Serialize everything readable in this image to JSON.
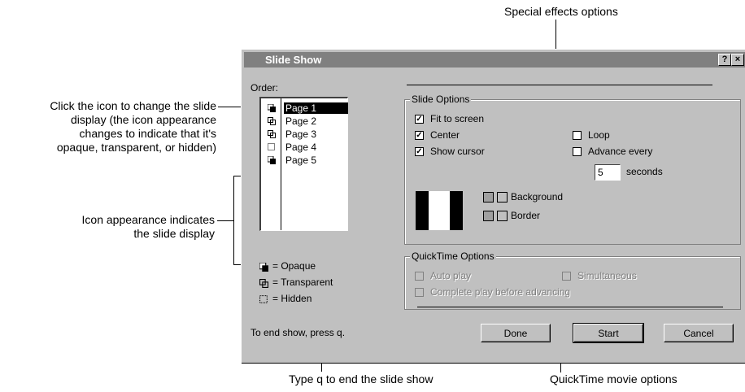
{
  "callouts": {
    "special_effects": "Special effects options",
    "icon_click": [
      "Click the icon to change the slide",
      "display (the icon appearance",
      "changes to indicate that it's",
      "opaque, transparent, or hidden)"
    ],
    "icon_appearance": [
      "Icon appearance indicates",
      "the slide display"
    ],
    "type_q": "Type q to end the slide show",
    "quicktime": "QuickTime movie options"
  },
  "dialog": {
    "title": "Slide Show",
    "help_btn": "?",
    "close_btn": "×",
    "order_label": "Order:",
    "pages": [
      {
        "label": "Page 1",
        "icon": "opaque-icon",
        "selected": true
      },
      {
        "label": "Page 2",
        "icon": "transparent-icon",
        "selected": false
      },
      {
        "label": "Page 3",
        "icon": "transparent-icon",
        "selected": false
      },
      {
        "label": "Page 4",
        "icon": "hidden-icon",
        "selected": false
      },
      {
        "label": "Page 5",
        "icon": "opaque-icon",
        "selected": false
      }
    ],
    "legend": {
      "opaque": "= Opaque",
      "transparent": "= Transparent",
      "hidden": "= Hidden"
    },
    "end_hint": "To end show, press q.",
    "slide_options": {
      "title": "Slide Options",
      "fit_to_screen": {
        "label": "Fit to screen",
        "checked": true
      },
      "center": {
        "label": "Center",
        "checked": true
      },
      "show_cursor": {
        "label": "Show cursor",
        "checked": true
      },
      "loop": {
        "label": "Loop",
        "checked": false
      },
      "advance_every": {
        "label": "Advance every",
        "checked": false
      },
      "seconds_value": "5",
      "seconds_label": "seconds",
      "background_label": "Background",
      "border_label": "Border"
    },
    "quicktime_options": {
      "title": "QuickTime Options",
      "auto_play": {
        "label": "Auto play",
        "checked": false
      },
      "simultaneous": {
        "label": "Simultaneous",
        "checked": false
      },
      "complete_play": {
        "label": "Complete play before advancing",
        "checked": false
      }
    },
    "buttons": {
      "done": "Done",
      "start": "Start",
      "cancel": "Cancel"
    }
  }
}
